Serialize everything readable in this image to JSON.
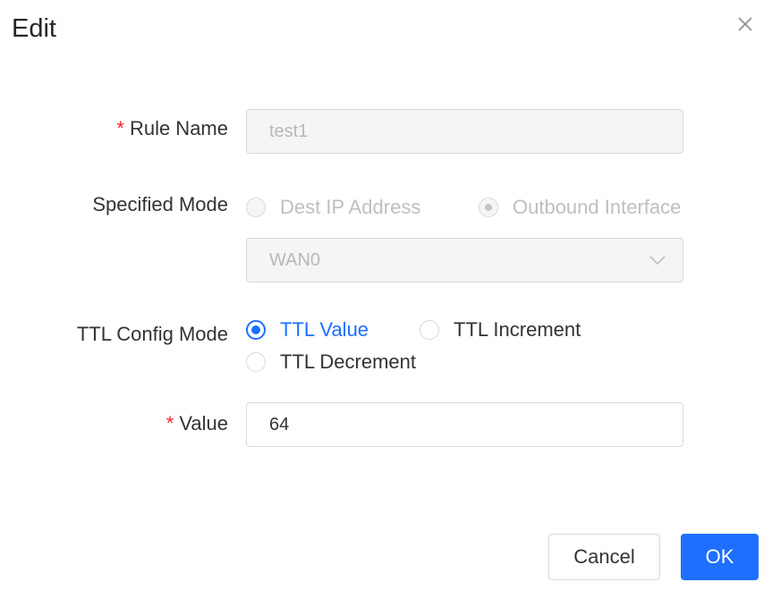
{
  "dialog": {
    "title": "Edit"
  },
  "form": {
    "rule_name": {
      "label": "Rule Name",
      "required_mark": "*",
      "value": "test1"
    },
    "specified_mode": {
      "label": "Specified Mode",
      "options": [
        "Dest IP Address",
        "Outbound Interface"
      ],
      "selected": "Outbound Interface",
      "interface_value": "WAN0"
    },
    "ttl_config_mode": {
      "label": "TTL Config Mode",
      "options": [
        "TTL Value",
        "TTL Increment",
        "TTL Decrement"
      ],
      "selected": "TTL Value"
    },
    "value": {
      "label": "Value",
      "required_mark": "*",
      "value": "64"
    }
  },
  "buttons": {
    "cancel": "Cancel",
    "ok": "OK"
  },
  "colors": {
    "primary": "#1e6fff",
    "required": "#f5222d",
    "disabled_bg": "#f5f5f5"
  }
}
